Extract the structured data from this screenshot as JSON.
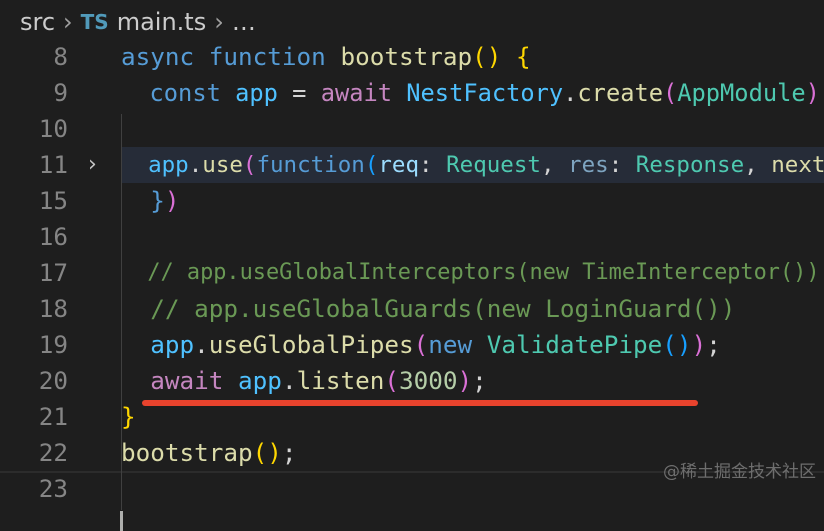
{
  "breadcrumb": {
    "items": [
      "src",
      "main.ts",
      "…"
    ],
    "file_icon": "TS"
  },
  "colors": {
    "background": "#1e1e1e",
    "highlight_underline": "#e8432d",
    "folded_line_bg": "#262c38"
  },
  "lines": [
    {
      "n": "8",
      "tokens": [
        [
          "async ",
          "kw"
        ],
        [
          "function ",
          "kw"
        ],
        [
          "bootstrap",
          "fn"
        ],
        [
          "()",
          "b1"
        ],
        [
          " ",
          "pl"
        ],
        [
          "{",
          "b1"
        ]
      ]
    },
    {
      "n": "9",
      "tokens": [
        [
          "  ",
          "pl"
        ],
        [
          "const ",
          "kw"
        ],
        [
          "app",
          "cv"
        ],
        [
          " = ",
          "pl"
        ],
        [
          "await ",
          "st"
        ],
        [
          "NestFactory",
          "cv"
        ],
        [
          ".",
          "pl"
        ],
        [
          "create",
          "fn"
        ],
        [
          "(",
          "b2"
        ],
        [
          "AppModule",
          "ty"
        ],
        [
          ")",
          "b2"
        ]
      ]
    },
    {
      "n": "10",
      "tokens": []
    },
    {
      "n": "11",
      "folded": true,
      "tokens": [
        [
          "  ",
          "pl"
        ],
        [
          "app",
          "cv"
        ],
        [
          ".",
          "pl"
        ],
        [
          "use",
          "fn"
        ],
        [
          "(",
          "b2"
        ],
        [
          "function",
          "kw"
        ],
        [
          "(",
          "b3"
        ],
        [
          "req",
          "vr"
        ],
        [
          ": ",
          "pl"
        ],
        [
          "Request",
          "ty"
        ],
        [
          ", ",
          "pl"
        ],
        [
          "res",
          "pm"
        ],
        [
          ": ",
          "pl"
        ],
        [
          "Response",
          "ty"
        ],
        [
          ", ",
          "pl"
        ],
        [
          "next",
          "fn"
        ]
      ]
    },
    {
      "n": "15",
      "tokens": [
        [
          "  ",
          "pl"
        ],
        [
          "}",
          "kw"
        ],
        [
          ")",
          "b2"
        ]
      ]
    },
    {
      "n": "16",
      "tokens": []
    },
    {
      "n": "17",
      "tokens": [
        [
          "  ",
          "pl"
        ],
        [
          "// app.useGlobalInterceptors(new TimeInterceptor())",
          "cm"
        ]
      ]
    },
    {
      "n": "18",
      "tokens": [
        [
          "  ",
          "pl"
        ],
        [
          "// app.useGlobalGuards(new LoginGuard())",
          "cm"
        ]
      ]
    },
    {
      "n": "19",
      "tokens": [
        [
          "  ",
          "pl"
        ],
        [
          "app",
          "cv"
        ],
        [
          ".",
          "pl"
        ],
        [
          "useGlobalPipes",
          "fn"
        ],
        [
          "(",
          "b2"
        ],
        [
          "new ",
          "kw"
        ],
        [
          "ValidatePipe",
          "ty"
        ],
        [
          "()",
          "b3"
        ],
        [
          ")",
          "b2"
        ],
        [
          ";",
          "pl"
        ]
      ]
    },
    {
      "n": "20",
      "tokens": [
        [
          "  ",
          "pl"
        ],
        [
          "await ",
          "st"
        ],
        [
          "app",
          "cv"
        ],
        [
          ".",
          "pl"
        ],
        [
          "listen",
          "fn"
        ],
        [
          "(",
          "b2"
        ],
        [
          "3000",
          "nu"
        ],
        [
          ")",
          "b2"
        ],
        [
          ";",
          "pl"
        ]
      ]
    },
    {
      "n": "21",
      "tokens": [
        [
          "}",
          "b1"
        ]
      ]
    },
    {
      "n": "22",
      "tokens": [
        [
          "bootstrap",
          "fn"
        ],
        [
          "()",
          "b1"
        ],
        [
          ";",
          "pl"
        ]
      ]
    },
    {
      "n": "23",
      "current": true,
      "tokens": []
    }
  ],
  "watermark": "@稀土掘金技术社区"
}
